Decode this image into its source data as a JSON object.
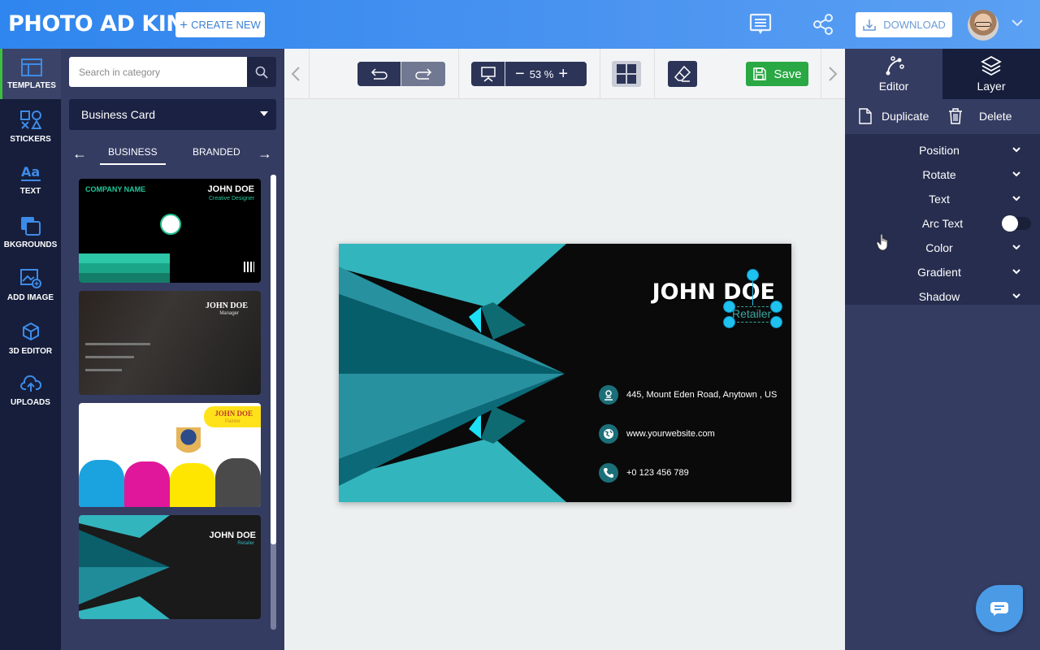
{
  "header": {
    "logo": "PHOTO AD KING",
    "create_new": "CREATE NEW",
    "download": "DOWNLOAD"
  },
  "iconbar": {
    "items": [
      {
        "label": "TEMPLATES",
        "icon": "templates-icon",
        "active": true
      },
      {
        "label": "STICKERS",
        "icon": "stickers-icon"
      },
      {
        "label": "TEXT",
        "icon": "text-icon"
      },
      {
        "label": "BKGROUNDS",
        "icon": "backgrounds-icon"
      },
      {
        "label": "ADD IMAGE",
        "icon": "add-image-icon"
      },
      {
        "label": "3D EDITOR",
        "icon": "3d-editor-icon"
      },
      {
        "label": "UPLOADS",
        "icon": "uploads-icon"
      }
    ]
  },
  "panel": {
    "search_placeholder": "Search in category",
    "category": "Business Card",
    "subtabs": [
      "BUSINESS",
      "BRANDED"
    ],
    "active_subtab": "BUSINESS",
    "thumbnails": [
      {
        "company": "COMPANY NAME",
        "name": "JOHN DOE",
        "role": "Creative Designer",
        "logo": "COMPANY LOGO"
      },
      {
        "name": "JOHN DOE",
        "role": "Manager"
      },
      {
        "name": "JOHN DOE",
        "role": "Painter"
      },
      {
        "name": "JOHN DOE",
        "role": "Retailer"
      }
    ]
  },
  "toolbar": {
    "zoom": "53 %",
    "save": "Save"
  },
  "card": {
    "name": "JOHN DOE",
    "role": "Retailer",
    "address": "445, Mount Eden Road, Anytown , US",
    "website": "www.yourwebsite.com",
    "phone": "+0 123 456 789"
  },
  "right_panel": {
    "tabs": [
      "Editor",
      "Layer"
    ],
    "active_tab": "Layer",
    "duplicate": "Duplicate",
    "delete": "Delete",
    "properties": [
      "Position",
      "Rotate",
      "Text",
      "Arc Text",
      "Color",
      "Gradient",
      "Shadow"
    ],
    "arc_text_enabled": false
  },
  "colors": {
    "header_blue": "#2f86ee",
    "sidebar_dark": "#161e3b",
    "panel_bg": "#353c62",
    "save_green": "#29a844",
    "teal": "#33b5bd",
    "active_indicator": "#3fbf3f"
  }
}
